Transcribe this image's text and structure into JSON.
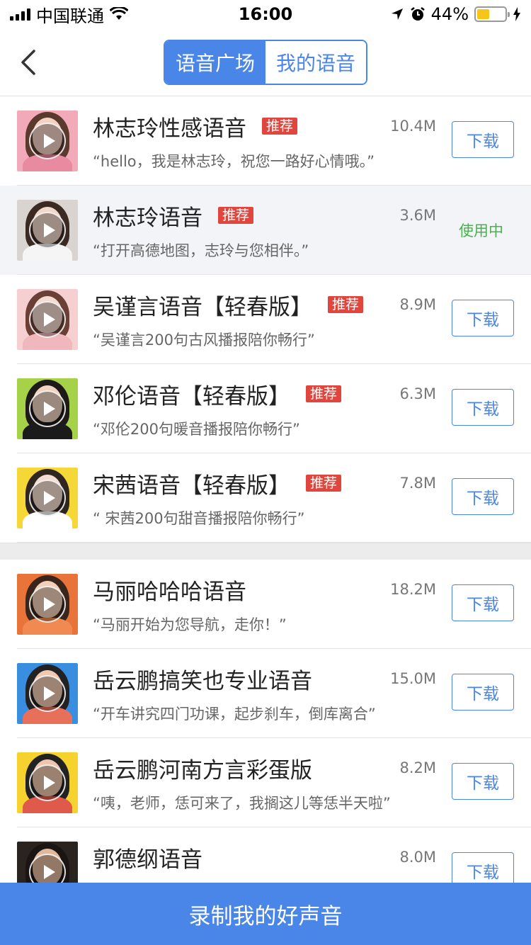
{
  "status_bar": {
    "carrier": "中国联通",
    "time": "16:00",
    "battery": "44%"
  },
  "nav": {
    "tabs": [
      {
        "label": "语音广场",
        "active": true
      },
      {
        "label": "我的语音",
        "active": false
      }
    ]
  },
  "voices_recommended": [
    {
      "title": "林志玲性感语音",
      "badge": "推荐",
      "size": "10.4M",
      "desc": "“hello，我是林志玲，祝您一路好心情哦。”",
      "action": "下载",
      "avatar_bg": "#f2a9b8",
      "skin": "#f3d2c3",
      "hair": "#5b3a2e",
      "clothes": "#e88aa0"
    },
    {
      "title": "林志玲语音",
      "badge": "推荐",
      "size": "3.6M",
      "desc": "“打开高德地图，志玲与您相伴。”",
      "action": "使用中",
      "avatar_bg": "#d9d4cf",
      "skin": "#f1d8ca",
      "hair": "#3b2a23",
      "clothes": "#f5f5f5"
    },
    {
      "title": "吴谨言语音【轻春版】",
      "badge": "推荐",
      "size": "8.9M",
      "desc": "“吴谨言200句古风播报陪你畅行”",
      "action": "下载",
      "avatar_bg": "#f6cfd0",
      "skin": "#f4dbd2",
      "hair": "#6a3f35",
      "clothes": "#f0b8bc"
    },
    {
      "title": "邓伦语音【轻春版】",
      "badge": "推荐",
      "size": "6.3M",
      "desc": "“邓伦200句暖音播报陪你畅行”",
      "action": "下载",
      "avatar_bg": "#a6d24a",
      "skin": "#f0d3c0",
      "hair": "#1d1a18",
      "clothes": "#1b1b1b"
    },
    {
      "title": "宋茜语音【轻春版】",
      "badge": "推荐",
      "size": "7.8M",
      "desc": "“ 宋茜200句甜音播报陪你畅行”",
      "action": "下载",
      "avatar_bg": "#f5d838",
      "skin": "#f4ddd2",
      "hair": "#2f2622",
      "clothes": "#ffffff"
    }
  ],
  "voices_more": [
    {
      "title": "马丽哈哈哈语音",
      "size": "18.2M",
      "desc": "“马丽开始为您导航，走你！”",
      "action": "下载",
      "avatar_bg": "#e8743a",
      "skin": "#f2cfb8",
      "hair": "#3a251c",
      "clothes": "#f08a52"
    },
    {
      "title": "岳云鹏搞笑也专业语音",
      "size": "15.0M",
      "desc": "“开车讲究四门功课，起步刹车，倒库离合”",
      "action": "下载",
      "avatar_bg": "#3a8ee0",
      "skin": "#f0c9b1",
      "hair": "#222222",
      "clothes": "#e86f5a"
    },
    {
      "title": "岳云鹏河南方言彩蛋版",
      "size": "8.2M",
      "desc": "“咦，老师，恁可来了，我搁这儿等恁半天啦”",
      "action": "下载",
      "avatar_bg": "#f6d22f",
      "skin": "#efc6ad",
      "hair": "#222222",
      "clothes": "#e05a4c"
    },
    {
      "title": "郭德纲语音",
      "size": "8.0M",
      "desc": "",
      "action": "下载",
      "avatar_bg": "#2a2420",
      "skin": "#e0b99c",
      "hair": "#1a1512",
      "clothes": "#3a2e26"
    }
  ],
  "bottom_button": "录制我的好声音"
}
